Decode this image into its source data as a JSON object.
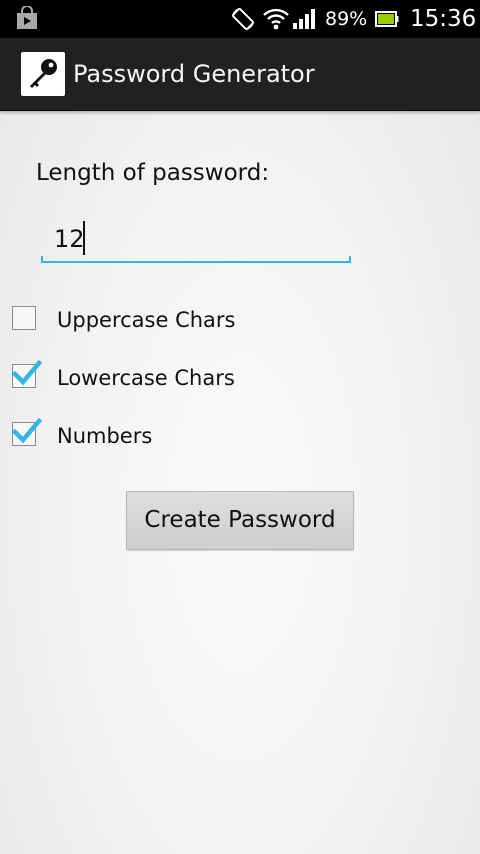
{
  "status_bar": {
    "battery_percent": "89%",
    "time": "15:36",
    "icons": [
      "shopping-bag-icon",
      "screen-rotation-icon",
      "wifi-icon",
      "signal-icon",
      "battery-icon"
    ]
  },
  "action_bar": {
    "title": "Password Generator",
    "icon": "key-icon"
  },
  "form": {
    "length_label": "Length of password:",
    "length_value": "12",
    "options": [
      {
        "label": "Uppercase Chars",
        "checked": false
      },
      {
        "label": "Lowercase Chars",
        "checked": true
      },
      {
        "label": "Numbers",
        "checked": true
      }
    ],
    "create_button_label": "Create Password"
  },
  "colors": {
    "accent": "#33b5e5",
    "action_bar_bg": "#212121",
    "status_bar_bg": "#000000",
    "battery": "#99cc00"
  }
}
